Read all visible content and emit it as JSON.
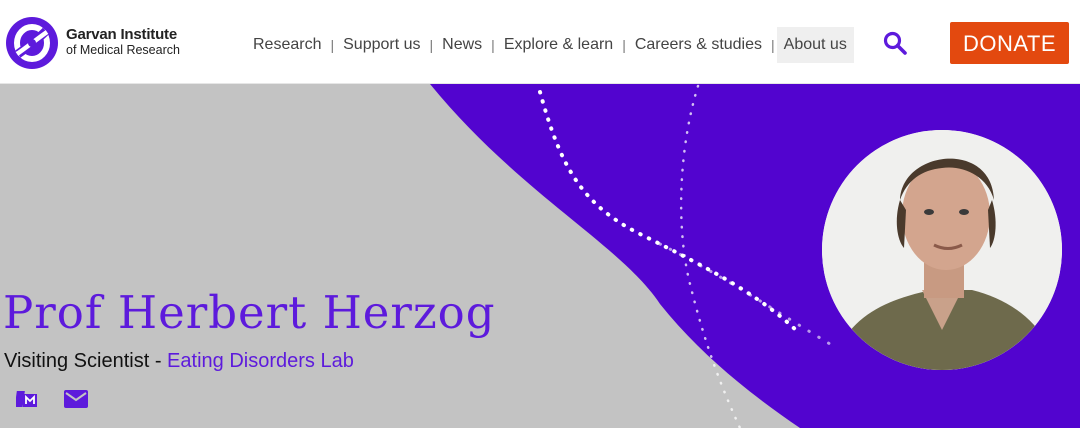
{
  "header": {
    "logo": {
      "name": "Garvan Institute",
      "subtitle": "of Medical Research",
      "icon": "garvan-logo"
    },
    "nav": [
      {
        "label": "Research"
      },
      {
        "label": "Support us"
      },
      {
        "label": "News"
      },
      {
        "label": "Explore & learn"
      },
      {
        "label": "Careers & studies"
      },
      {
        "label": "About us",
        "active": true
      }
    ],
    "nav_separator": "|",
    "search_icon": "search-icon",
    "donate_label": "DONATE"
  },
  "profile": {
    "name": "Prof Herbert Herzog",
    "title": "Visiting Scientist",
    "separator": " - ",
    "lab": "Eating Disorders Lab",
    "social_icons": [
      "orcid-icon",
      "email-icon"
    ]
  },
  "colors": {
    "brand_purple": "#5d1adc",
    "hero_purple": "#5204cf",
    "hero_gray": "#c3c3c3",
    "donate_orange": "#e3490f"
  }
}
